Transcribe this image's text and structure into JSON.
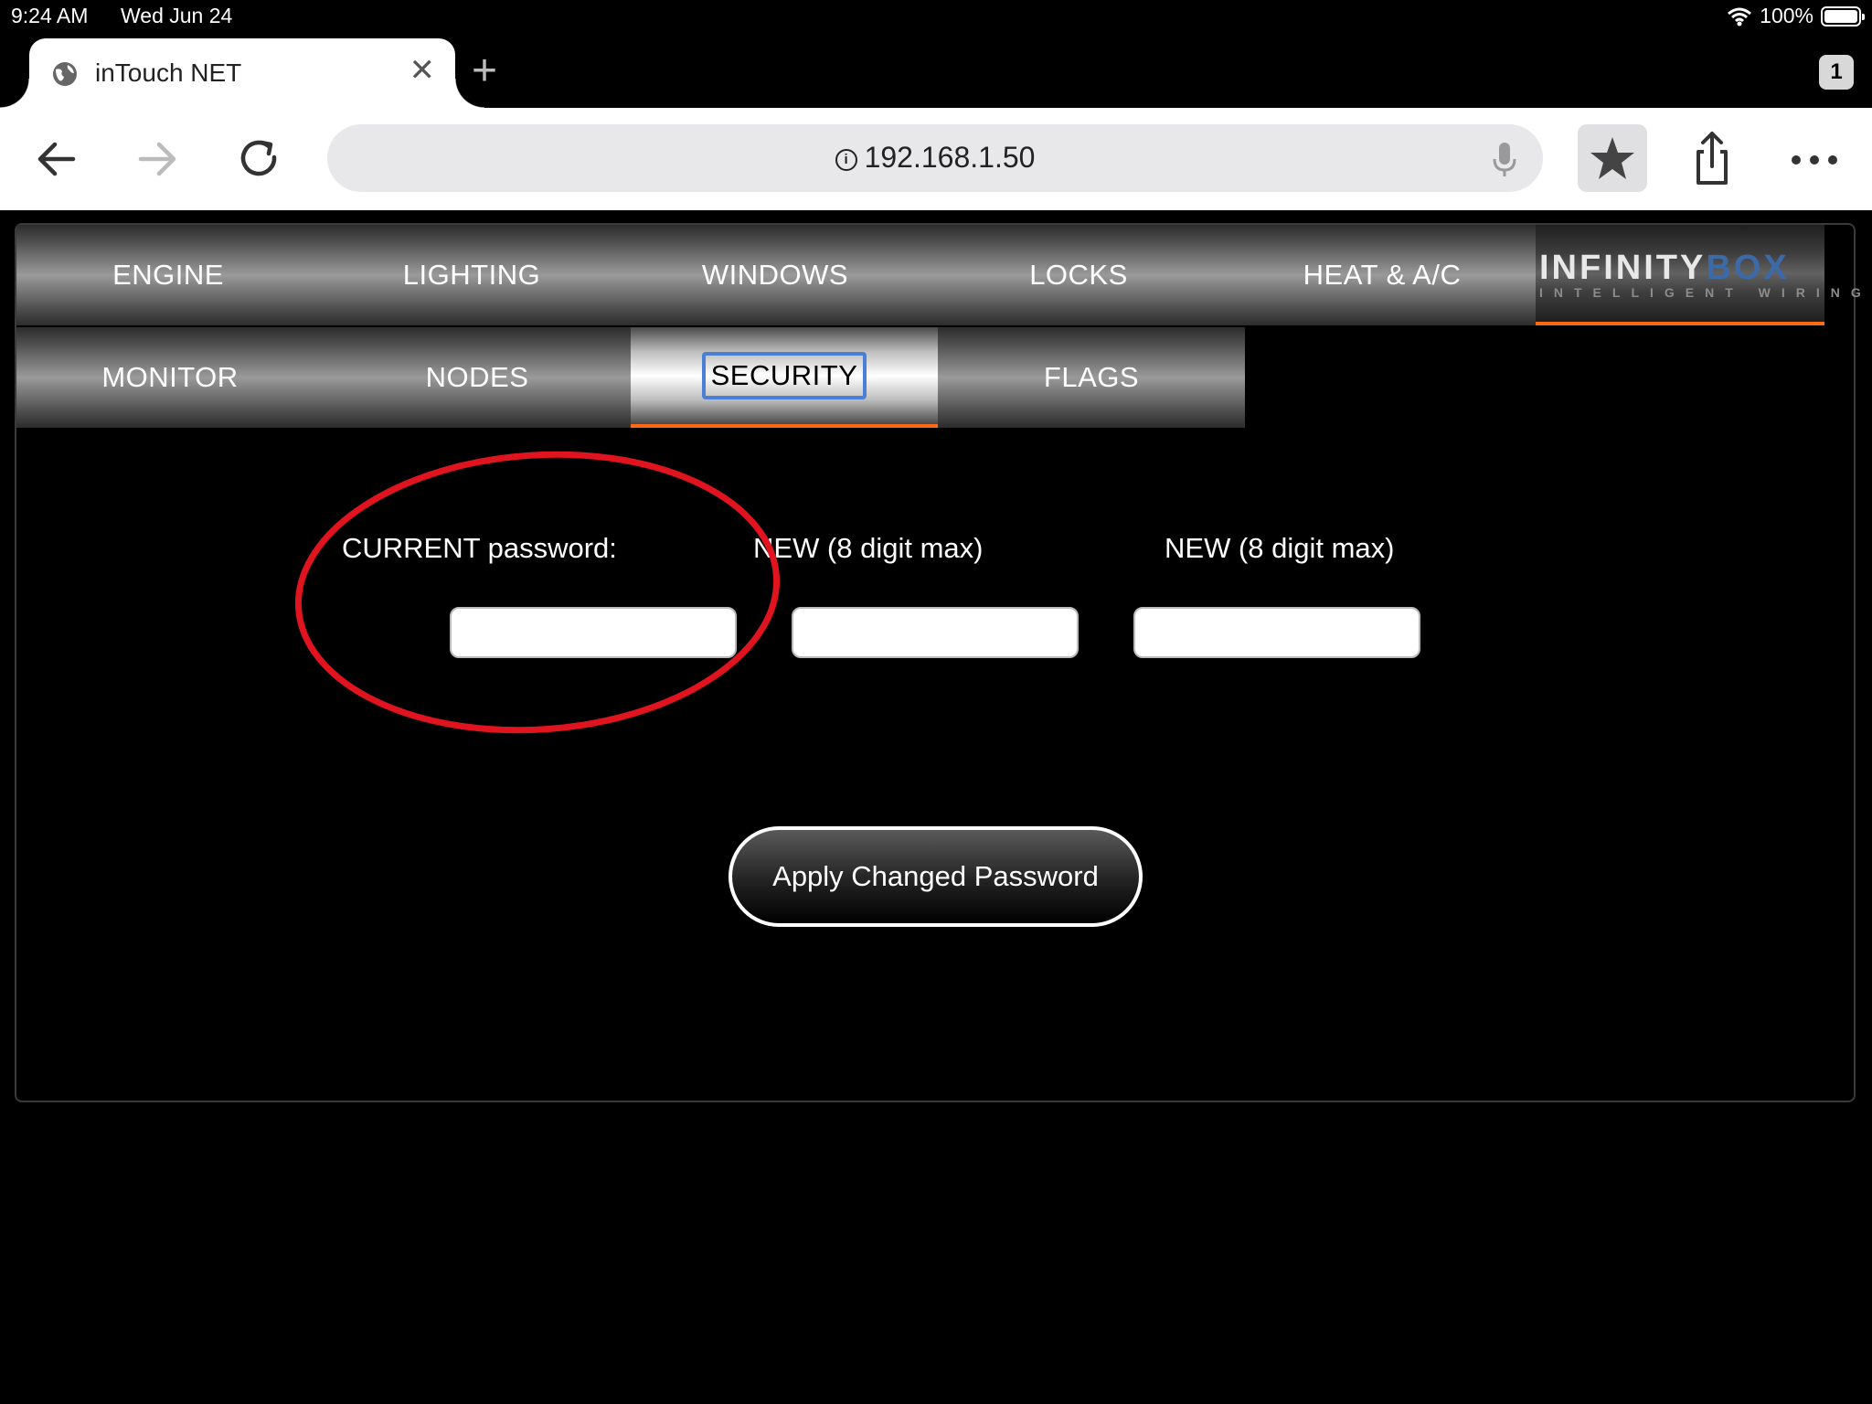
{
  "status": {
    "time": "9:24 AM",
    "date": "Wed Jun 24",
    "battery": "100%"
  },
  "browser": {
    "tab_title": "inTouch NET",
    "tab_count": "1",
    "url": "192.168.1.50"
  },
  "nav": {
    "row1": [
      "ENGINE",
      "LIGHTING",
      "WINDOWS",
      "LOCKS",
      "HEAT & A/C"
    ],
    "row2": [
      "MONITOR",
      "NODES",
      "SECURITY",
      "FLAGS"
    ],
    "active": "SECURITY"
  },
  "logo": {
    "main_a": "INFINITY",
    "main_b": "BOX",
    "sub": "INTELLIGENT WIRING"
  },
  "form": {
    "current_label": "CURRENT password:",
    "new_label": "NEW (8 digit max)",
    "confirm_label": "NEW (8 digit max)",
    "current_value": "",
    "new_value": "",
    "confirm_value": "",
    "apply_label": "Apply Changed Password"
  },
  "colors": {
    "accent_orange": "#ff6a14",
    "focus_blue": "#4a7fd6",
    "annotation_red": "#e0141e"
  }
}
